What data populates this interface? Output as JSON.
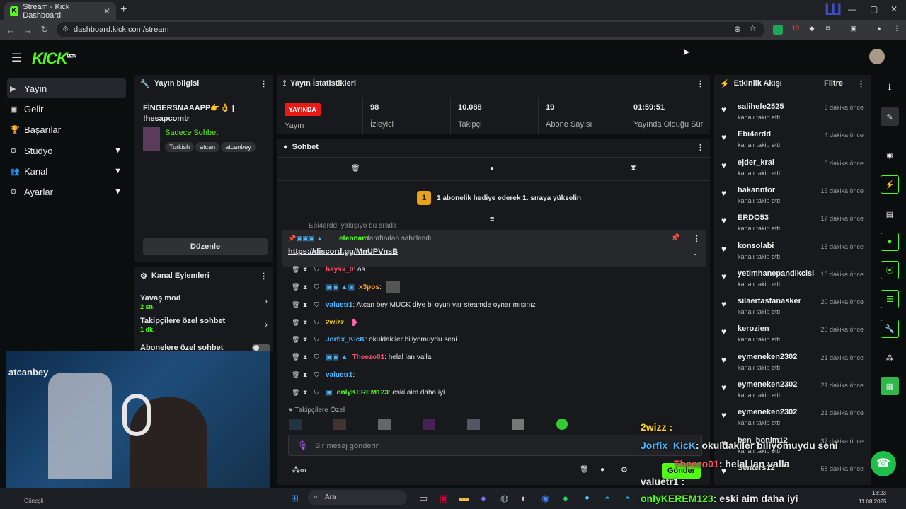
{
  "browser": {
    "tab_title": "Stream - Kick Dashboard",
    "tab_close": "✕",
    "new_tab": "+",
    "url": "dashboard.kick.com/stream",
    "ext_badge": "10"
  },
  "header": {
    "logo": "KICK",
    "logo_badge": "BETA"
  },
  "sidebar": {
    "items": [
      {
        "label": "Yayın",
        "icon": "▶"
      },
      {
        "label": "Gelir",
        "icon": "▣"
      },
      {
        "label": "Başarılar",
        "icon": "🏆"
      },
      {
        "label": "Stüdyo",
        "icon": "⚙"
      },
      {
        "label": "Kanal",
        "icon": "👥"
      },
      {
        "label": "Ayarlar",
        "icon": "⚙"
      }
    ]
  },
  "stream_info": {
    "title": "Yayın bilgisi",
    "stream_title": "FİNGERSNAAAPP👉👌 | !hesapcomtr",
    "category": "Sadece Sohbet",
    "tags": [
      "Turkish",
      "atcan",
      "atcanbey"
    ],
    "edit_button": "Düzenle"
  },
  "channel_actions": {
    "title": "Kanal Eylemleri",
    "slow_mode": "Yavaş mod",
    "slow_mode_value": "2 sn.",
    "followers_only": "Takipçilere özel sohbet",
    "followers_only_value": "1 dk.",
    "subs_only": "Abonelere özel sohbet"
  },
  "stats": {
    "title": "Yayın İstatistikleri",
    "live_badge": "YAYINDA",
    "live_label": "Yayın",
    "viewers": "98",
    "viewers_label": "İzleyici",
    "followers": "10.088",
    "followers_label": "Takipçi",
    "subs": "19",
    "subs_label": "Abone Sayısı",
    "uptime": "01:59:51",
    "uptime_label": "Yayında Olduğu Süre"
  },
  "chat": {
    "title": "Sohbet",
    "gift_banner": "1 abonelik hediye ederek 1. sıraya yükselin",
    "gift_rank": "1",
    "pinned_by": "etennam",
    "pinned_suffix": "tarafından sabitlendi",
    "pinned_link": "https://discord.gg/MnUPVnsB",
    "partial_top": "Ebi4erdd: yakışıyo bu arada",
    "messages": [
      {
        "user": "baysx_0",
        "text": ": as",
        "color": "#ff4d6a"
      },
      {
        "user": "x3pos",
        "text": ":",
        "color": "#ff9b1f"
      },
      {
        "user": "valuetr1",
        "text": ": Atcan bey MUCK diye bi oyun var steamde oynar mısınız",
        "color": "#4db8ff"
      },
      {
        "user": "2wizz",
        "text": ":",
        "color": "#ffd21f"
      },
      {
        "user": "Jorfix_KicK",
        "text": ": okuldakiler biliyomuydu seni",
        "color": "#4db8ff"
      },
      {
        "user": "Theezo01",
        "text": ": helal lan valla",
        "color": "#ff4d6a"
      },
      {
        "user": "valuetr1",
        "text": ":",
        "color": "#4db8ff"
      },
      {
        "user": "onlyKEREM123",
        "text": ": eski aim daha iyi",
        "color": "#53fc18"
      }
    ],
    "followers_only_label": "Takipçilere Özel",
    "input_placeholder": "Bir mesaj gönderin",
    "send_button": "Gönder"
  },
  "activity": {
    "title": "Etkinlik Akışı",
    "filter": "Filtre",
    "events": [
      {
        "name": "salihefe2525",
        "sub": "kanalı takip etti",
        "time": "3 dakika önce"
      },
      {
        "name": "Ebi4erdd",
        "sub": "kanalı takip etti",
        "time": "4 dakika önce"
      },
      {
        "name": "ejder_kral",
        "sub": "kanalı takip etti",
        "time": "8 dakika önce"
      },
      {
        "name": "hakanntor",
        "sub": "kanalı takip etti",
        "time": "15 dakika önce"
      },
      {
        "name": "ERDO53",
        "sub": "kanalı takip etti",
        "time": "17 dakika önce"
      },
      {
        "name": "konsolabi",
        "sub": "kanalı takip etti",
        "time": "18 dakika önce"
      },
      {
        "name": "yetimhanepandikcisi",
        "sub": "kanalı takip etti",
        "time": "18 dakika önce"
      },
      {
        "name": "silaertasfanasker",
        "sub": "kanalı takip etti",
        "time": "20 dakika önce"
      },
      {
        "name": "kerozien",
        "sub": "kanalı takip etti",
        "time": "20 dakika önce"
      },
      {
        "name": "eymeneken2302",
        "sub": "kanalı takip etti",
        "time": "21 dakika önce"
      },
      {
        "name": "eymeneken2302",
        "sub": "kanalı takip etti",
        "time": "21 dakika önce"
      },
      {
        "name": "eymeneken2302",
        "sub": "kanalı takip etti",
        "time": "21 dakika önce"
      },
      {
        "name": "ben_bonim12",
        "sub": "kanalı takip etti",
        "time": "37 dakika önce"
      },
      {
        "name": "Senters12",
        "sub": "",
        "time": "58 dakika önce"
      }
    ]
  },
  "webcam": {
    "name": "atcanbey"
  },
  "overlay": {
    "l1": "2wizz :",
    "l2_user": "Jorfix_KicK",
    "l2_text": ": okuldakiler biliyomuydu seni",
    "l3_user": "Theezo01",
    "l3_text": ": helal lan valla",
    "l4": "valuetr1 :",
    "l5_user": "onlyKEREM123",
    "l5_text": ": eski aim daha iyi"
  },
  "taskbar": {
    "search": "Ara",
    "time": "18:23",
    "date": "11.08.2025",
    "weather": "Güneşli"
  },
  "colors": {
    "accent": "#53fc18",
    "live": "#e91916",
    "panel": "#18191c"
  }
}
